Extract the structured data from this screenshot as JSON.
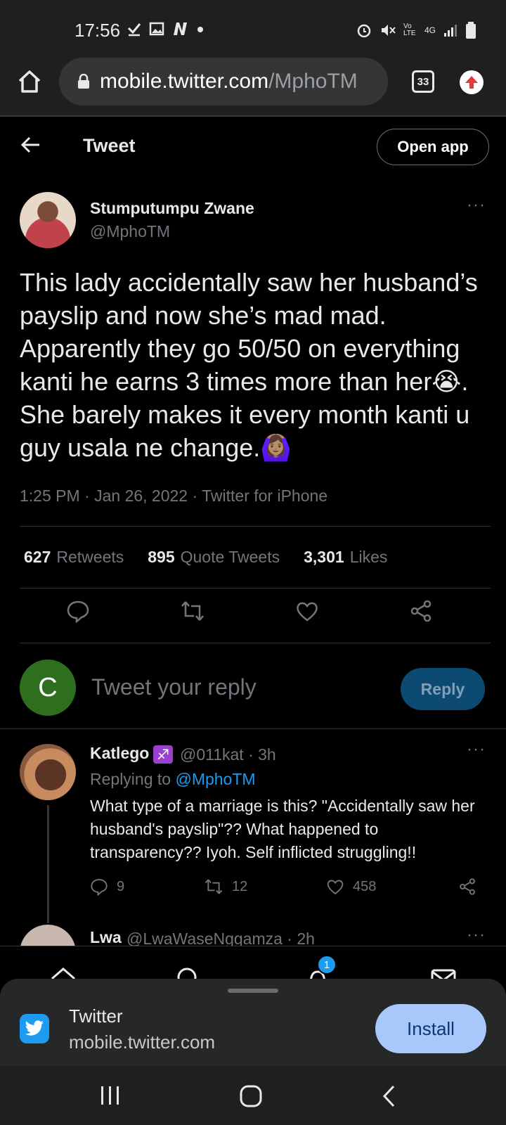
{
  "status_bar": {
    "time": "17:56",
    "left_icons": [
      "check-icon",
      "image-icon",
      "netflix-icon",
      "dot-icon"
    ],
    "right_icons": [
      "alarm-icon",
      "mute-icon",
      "volte-icon",
      "4g-icon",
      "signal-icon",
      "battery-icon"
    ],
    "volte": "Vo LTE",
    "network": "4G"
  },
  "browser": {
    "url_host": "mobile.twitter.com",
    "url_path": "/MphoTM",
    "tab_count": "33"
  },
  "header": {
    "title": "Tweet",
    "open_app": "Open app"
  },
  "tweet": {
    "author_name": "Stumputumpu Zwane",
    "author_handle": "@MphoTM",
    "text": "This lady accidentally saw her husband’s payslip and now she’s mad mad. Apparently they go 50/50 on everything kanti he earns 3 times more than her😭. She barely makes it every month kanti u guy usala ne change.🙆🏽‍♀️",
    "meta": "1:25 PM · Jan 26, 2022 · Twitter for iPhone",
    "retweets_count": "627",
    "retweets_label": "Retweets",
    "quotes_count": "895",
    "quotes_label": "Quote Tweets",
    "likes_count": "3,301",
    "likes_label": "Likes",
    "more": "···"
  },
  "reply_box": {
    "avatar_letter": "C",
    "placeholder": "Tweet your reply",
    "button": "Reply"
  },
  "replies": [
    {
      "name": "Katlego",
      "emoji": "♐",
      "handle_time": "@011kat · 3h",
      "replying_prefix": "Replying to ",
      "replying_to": "@MphoTM",
      "text": "What type of a marriage is this? \"Accidentally saw her husband's payslip\"?? What happened to transparency?? Iyoh. Self inflicted struggling!!",
      "reply_count": "9",
      "retweet_count": "12",
      "like_count": "458",
      "more": "···"
    },
    {
      "name": "Lwa",
      "handle_time": "@LwaWaseNggamza · 2h",
      "more": "···"
    }
  ],
  "bottom_nav": {
    "notification_badge": "1"
  },
  "install_sheet": {
    "app_name": "Twitter",
    "app_url": "mobile.twitter.com",
    "install": "Install"
  },
  "colors": {
    "accent": "#1d9bf0",
    "background": "#000000",
    "muted_text": "#71767b",
    "install_button": "#a8c7fa"
  }
}
